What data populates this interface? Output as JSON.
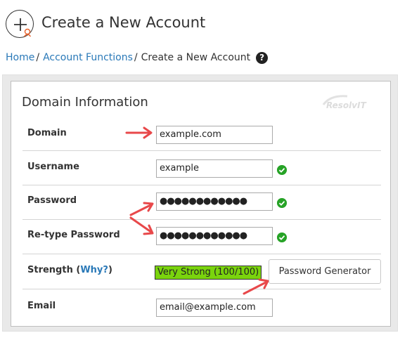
{
  "header": {
    "title": "Create a New Account"
  },
  "breadcrumb": {
    "home": "Home",
    "section": "Account Functions",
    "current": "Create a New Account",
    "sep": "/",
    "help": "?"
  },
  "panel": {
    "title": "Domain Information",
    "watermark": "ResolvIT"
  },
  "form": {
    "domain": {
      "label": "Domain",
      "value": "example.com"
    },
    "username": {
      "label": "Username",
      "value": "example"
    },
    "password": {
      "label": "Password",
      "value": "●●●●●●●●●●●●"
    },
    "retype": {
      "label": "Re-type Password",
      "value": "●●●●●●●●●●●●"
    },
    "strength": {
      "label": "Strength",
      "why_link": "Why?",
      "open_paren": "(",
      "close_paren": ")",
      "value": "Very Strong (100/100)",
      "generator_button": "Password Generator"
    },
    "email": {
      "label": "Email",
      "value": "email@example.com"
    }
  },
  "colors": {
    "link": "#2a79b8",
    "strength_bg": "#7ad40d",
    "valid_check": "#27a327",
    "annotation_arrow": "#e8484a"
  }
}
